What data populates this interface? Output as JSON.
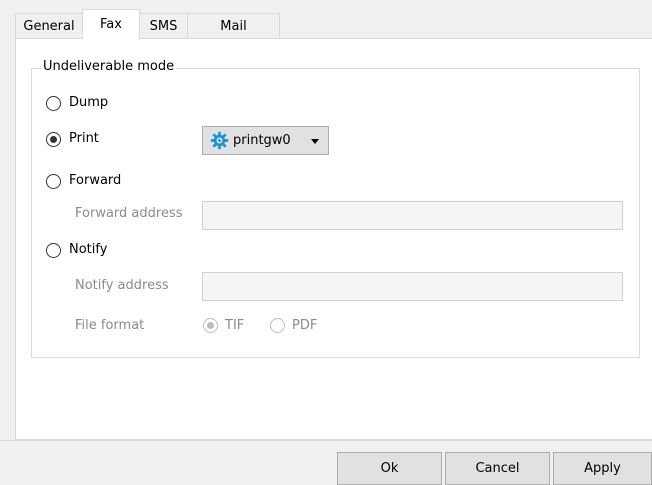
{
  "tabs": [
    {
      "label": "General"
    },
    {
      "label": "Fax"
    },
    {
      "label": "SMS"
    },
    {
      "label": "Mail"
    }
  ],
  "active_tab": "Fax",
  "group_title": "Undeliverable mode",
  "options": {
    "dump": {
      "label": "Dump",
      "checked": false
    },
    "print": {
      "label": "Print",
      "checked": true
    },
    "forward": {
      "label": "Forward",
      "checked": false
    },
    "notify": {
      "label": "Notify",
      "checked": false
    }
  },
  "printer_select": {
    "value": "printgw0",
    "icon": "gear-icon",
    "icon_color": "#1e90d8"
  },
  "forward_address": {
    "label": "Forward address",
    "value": ""
  },
  "notify_address": {
    "label": "Notify address",
    "value": ""
  },
  "file_format": {
    "label": "File format",
    "options": [
      {
        "label": "TIF",
        "checked": true
      },
      {
        "label": "PDF",
        "checked": false
      }
    ]
  },
  "buttons": {
    "ok": "Ok",
    "cancel": "Cancel",
    "apply": "Apply"
  }
}
